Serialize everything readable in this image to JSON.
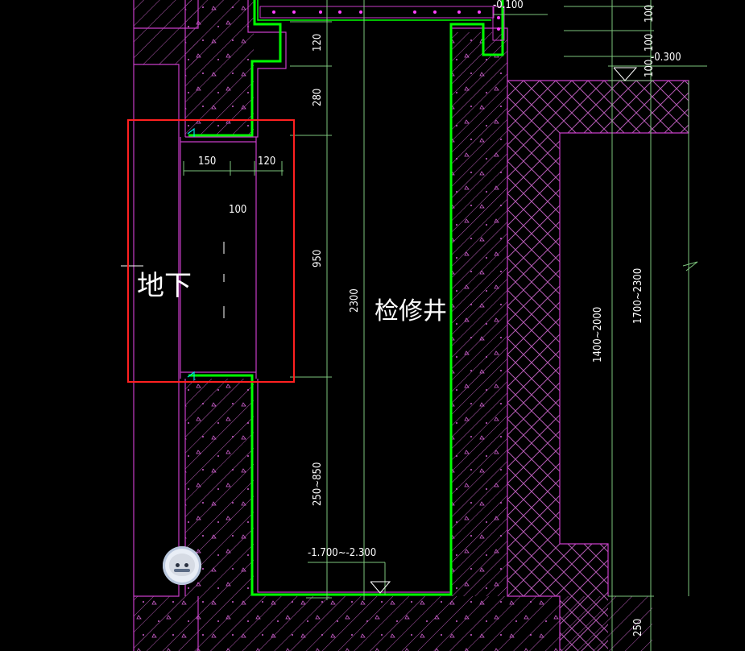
{
  "labels": {
    "room": "检修井",
    "underground": "地下",
    "depth_range": "-1.700~-2.300",
    "level_top": "-0.100",
    "level_right": "-0.300",
    "height_total": "2300",
    "dim_120_vertical": "120",
    "dim_280": "280",
    "dim_950": "950",
    "dim_250_850": "250~850",
    "dim_150": "150",
    "dim_120_horizontal": "120",
    "dim_100_center": "100",
    "dim_1400_2000": "1400~2000",
    "dim_1700_2300": "1700~2300",
    "dim_250_bottom": "250",
    "dim_100_a": "100",
    "dim_100_b": "100",
    "dim_100_c": "100"
  },
  "colors": {
    "background": "#000000",
    "wall_line": "#c83cc8",
    "waterproof_line": "#00ff00",
    "dim_line": "#7cc47c",
    "highlight_box": "#ff2020",
    "text": "#ffffff"
  },
  "icons": {
    "avatar": "assistant-avatar-icon"
  }
}
